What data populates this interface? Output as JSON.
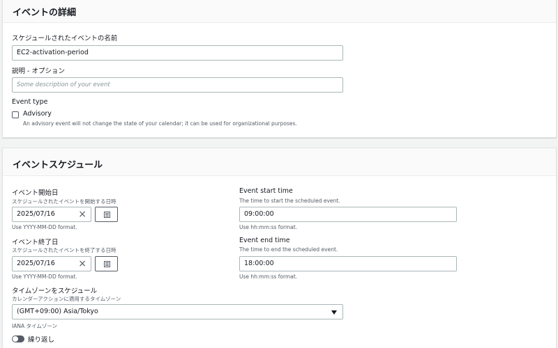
{
  "event_details": {
    "title": "イベントの詳細",
    "name_label": "スケジュールされたイベントの名前",
    "name_value": "EC2-activation-period",
    "description_label": "説明 - オプション",
    "description_placeholder": "Some description of your event",
    "event_type_label": "Event type",
    "advisory_label": "Advisory",
    "advisory_desc": "An advisory event will not change the state of your calendar; it can be used for organizational purposes."
  },
  "event_schedule": {
    "title": "イベントスケジュール",
    "start_date_label": "イベント開始日",
    "start_date_desc": "スケジュールされたイベントを開始する日時",
    "start_date_value": "2025/07/16",
    "start_date_hint": "Use YYYY-MM-DD format.",
    "start_time_label": "Event start time",
    "start_time_desc": "The time to start the scheduled event.",
    "start_time_value": "09:00:00",
    "start_time_hint": "Use hh:mm:ss format.",
    "end_date_label": "イベント終了日",
    "end_date_desc": "スケジュールされたイベントを終了する日時",
    "end_date_value": "2025/07/16",
    "end_date_hint": "Use YYYY-MM-DD format.",
    "end_time_label": "Event end time",
    "end_time_desc": "The time to end the scheduled event.",
    "end_time_value": "18:00:00",
    "end_time_hint": "Use hh:mm:ss format.",
    "timezone_label": "タイムゾーンをスケジュール",
    "timezone_desc": "カレンダーアクションに適用するタイムゾーン",
    "timezone_value": "(GMT+09:00) Asia/Tokyo",
    "timezone_hint": "IANA タイムゾーン",
    "repeat_label": "繰り返し"
  },
  "icons": {
    "clear": "×"
  }
}
